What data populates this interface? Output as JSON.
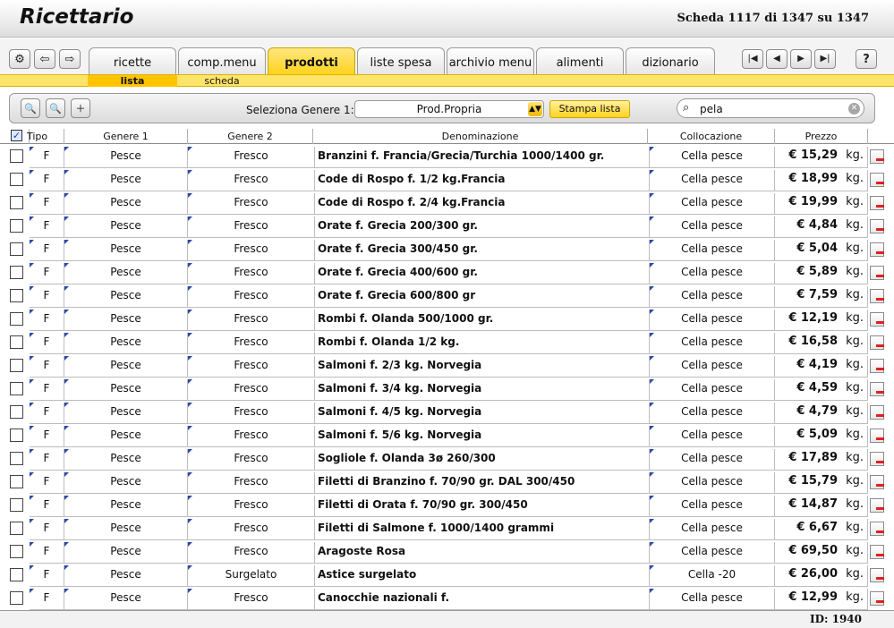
{
  "app": {
    "title": "Ricettario",
    "record_info": "Scheda 1117 di 1347 su 1347"
  },
  "toolbar": {
    "icons": [
      "settings-icon",
      "back-arrow-icon",
      "forward-arrow-icon"
    ],
    "tabs": [
      "ricette",
      "comp.menu",
      "prodotti",
      "liste spesa",
      "archivio menu",
      "alimenti",
      "dizionario"
    ],
    "active_tab": "prodotti",
    "nav_first": "|◀",
    "nav_prev": "◀",
    "nav_next": "▶",
    "nav_last": "▶|",
    "help": "?"
  },
  "subtabs": [
    "lista",
    "scheda"
  ],
  "filter": {
    "genre_label": "Seleziona Genere 1:",
    "genre_value": "Prod.Propria",
    "print_label": "Stampa lista",
    "search_value": "pela"
  },
  "table": {
    "headers": [
      "Tipo",
      "Genere 1",
      "Genere 2",
      "Denominazione",
      "Collocazione",
      "Prezzo"
    ],
    "rows": [
      {
        "tipo": "F",
        "g1": "Pesce",
        "g2": "Fresco",
        "den": "Branzini f. Francia/Grecia/Turchia  1000/1400 gr.",
        "col": "Cella pesce",
        "price": "€ 15,29",
        "unit": "kg."
      },
      {
        "tipo": "F",
        "g1": "Pesce",
        "g2": "Fresco",
        "den": "Code di Rospo f. 1/2 kg.Francia",
        "col": "Cella pesce",
        "price": "€ 18,99",
        "unit": "kg."
      },
      {
        "tipo": "F",
        "g1": "Pesce",
        "g2": "Fresco",
        "den": "Code di Rospo f. 2/4 kg.Francia",
        "col": "Cella pesce",
        "price": "€ 19,99",
        "unit": "kg."
      },
      {
        "tipo": "F",
        "g1": "Pesce",
        "g2": "Fresco",
        "den": "Orate f. Grecia  200/300 gr.",
        "col": "Cella pesce",
        "price": "€ 4,84",
        "unit": "kg."
      },
      {
        "tipo": "F",
        "g1": "Pesce",
        "g2": "Fresco",
        "den": "Orate f. Grecia 300/450 gr.",
        "col": "Cella pesce",
        "price": "€ 5,04",
        "unit": "kg."
      },
      {
        "tipo": "F",
        "g1": "Pesce",
        "g2": "Fresco",
        "den": "Orate f. Grecia 400/600 gr.",
        "col": "Cella pesce",
        "price": "€ 5,89",
        "unit": "kg."
      },
      {
        "tipo": "F",
        "g1": "Pesce",
        "g2": "Fresco",
        "den": "Orate f. Grecia 600/800 gr",
        "col": "Cella pesce",
        "price": "€ 7,59",
        "unit": "kg."
      },
      {
        "tipo": "F",
        "g1": "Pesce",
        "g2": "Fresco",
        "den": "Rombi f. Olanda 500/1000 gr.",
        "col": "Cella pesce",
        "price": "€ 12,19",
        "unit": "kg."
      },
      {
        "tipo": "F",
        "g1": "Pesce",
        "g2": "Fresco",
        "den": "Rombi f. Olanda 1/2 kg.",
        "col": "Cella pesce",
        "price": "€ 16,58",
        "unit": "kg."
      },
      {
        "tipo": "F",
        "g1": "Pesce",
        "g2": "Fresco",
        "den": "Salmoni f. 2/3 kg. Norvegia",
        "col": "Cella pesce",
        "price": "€ 4,19",
        "unit": "kg."
      },
      {
        "tipo": "F",
        "g1": "Pesce",
        "g2": "Fresco",
        "den": "Salmoni f. 3/4 kg. Norvegia",
        "col": "Cella pesce",
        "price": "€ 4,59",
        "unit": "kg."
      },
      {
        "tipo": "F",
        "g1": "Pesce",
        "g2": "Fresco",
        "den": "Salmoni f. 4/5 kg. Norvegia",
        "col": "Cella pesce",
        "price": "€ 4,79",
        "unit": "kg."
      },
      {
        "tipo": "F",
        "g1": "Pesce",
        "g2": "Fresco",
        "den": "Salmoni f. 5/6 kg. Norvegia",
        "col": "Cella pesce",
        "price": "€ 5,09",
        "unit": "kg."
      },
      {
        "tipo": "F",
        "g1": "Pesce",
        "g2": "Fresco",
        "den": "Sogliole f. Olanda 3ø 260/300",
        "col": "Cella pesce",
        "price": "€ 17,89",
        "unit": "kg."
      },
      {
        "tipo": "F",
        "g1": "Pesce",
        "g2": "Fresco",
        "den": "Filetti di Branzino f. 70/90  gr. DAL 300/450",
        "col": "Cella pesce",
        "price": "€ 15,79",
        "unit": "kg."
      },
      {
        "tipo": "F",
        "g1": "Pesce",
        "g2": "Fresco",
        "den": "Filetti di Orata f. 70/90 gr. 300/450",
        "col": "Cella pesce",
        "price": "€ 14,87",
        "unit": "kg."
      },
      {
        "tipo": "F",
        "g1": "Pesce",
        "g2": "Fresco",
        "den": "Filetti di Salmone f. 1000/1400 grammi",
        "col": "Cella pesce",
        "price": "€ 6,67",
        "unit": "kg."
      },
      {
        "tipo": "F",
        "g1": "Pesce",
        "g2": "Fresco",
        "den": "Aragoste Rosa",
        "col": "Cella pesce",
        "price": "€ 69,50",
        "unit": "kg."
      },
      {
        "tipo": "F",
        "g1": "Pesce",
        "g2": "Surgelato",
        "den": "Astice surgelato",
        "col": "Cella -20",
        "price": "€ 26,00",
        "unit": "kg."
      },
      {
        "tipo": "F",
        "g1": "Pesce",
        "g2": "Fresco",
        "den": "Canocchie nazionali f.",
        "col": "Cella pesce",
        "price": "€ 12,99",
        "unit": "kg."
      }
    ]
  },
  "footer": {
    "id_label": "ID: 1940"
  },
  "colors": {
    "accent": "#ffd21a",
    "tab_active": "#ffc400"
  }
}
